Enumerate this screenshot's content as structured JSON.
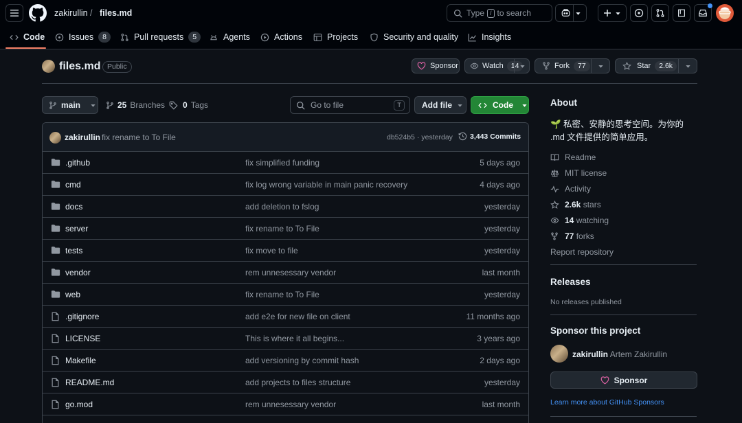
{
  "header": {
    "owner": "zakirullin",
    "separator": "/",
    "repo": "files.md",
    "search_prefix": "Type",
    "search_key": "/",
    "search_suffix": "to search"
  },
  "tabs": [
    {
      "label": "Code",
      "count": null
    },
    {
      "label": "Issues",
      "count": "8"
    },
    {
      "label": "Pull requests",
      "count": "5"
    },
    {
      "label": "Agents",
      "count": null
    },
    {
      "label": "Actions",
      "count": null
    },
    {
      "label": "Projects",
      "count": null
    },
    {
      "label": "Security and quality",
      "count": null
    },
    {
      "label": "Insights",
      "count": null
    }
  ],
  "repo": {
    "name": "files.md",
    "visibility": "Public",
    "sponsor_label": "Sponsor",
    "watch_label": "Watch",
    "watch_count": "14",
    "fork_label": "Fork",
    "fork_count": "77",
    "star_label": "Star",
    "star_count": "2.6k"
  },
  "toolbar": {
    "branch": "main",
    "branches_count": "25",
    "branches_label": "Branches",
    "tags_count": "0",
    "tags_label": "Tags",
    "goto_placeholder": "Go to file",
    "goto_key": "T",
    "add_file_label": "Add file",
    "code_label": "Code"
  },
  "commit": {
    "author": "zakirullin",
    "message": "fix rename to To File",
    "hash": "db524b5",
    "dot": "·",
    "time": "yesterday",
    "commits_label": "3,443 Commits"
  },
  "files": [
    {
      "name": ".github",
      "type": "folder",
      "message": "fix simplified funding",
      "date": "5 days ago"
    },
    {
      "name": "cmd",
      "type": "folder",
      "message": "fix log wrong variable in main panic recovery",
      "date": "4 days ago"
    },
    {
      "name": "docs",
      "type": "folder",
      "message": "add deletion to fslog",
      "date": "yesterday"
    },
    {
      "name": "server",
      "type": "folder",
      "message": "fix rename to To File",
      "date": "yesterday"
    },
    {
      "name": "tests",
      "type": "folder",
      "message": "fix move to file",
      "date": "yesterday"
    },
    {
      "name": "vendor",
      "type": "folder",
      "message": "rem unnesessary vendor",
      "date": "last month"
    },
    {
      "name": "web",
      "type": "folder",
      "message": "fix rename to To File",
      "date": "yesterday"
    },
    {
      "name": ".gitignore",
      "type": "file",
      "message": "add e2e for new file on client",
      "date": "11 months ago"
    },
    {
      "name": "LICENSE",
      "type": "file",
      "message": "This is where it all begins...",
      "date": "3 years ago"
    },
    {
      "name": "Makefile",
      "type": "file",
      "message": "add versioning by commit hash",
      "date": "2 days ago"
    },
    {
      "name": "README.md",
      "type": "file",
      "message": "add projects to files structure",
      "date": "yesterday"
    },
    {
      "name": "go.mod",
      "type": "file",
      "message": "rem unnesessary vendor",
      "date": "last month"
    }
  ],
  "about": {
    "title": "About",
    "description_line1": "🌱 私密、安静的思考空间。为你的",
    "description_line2": ".md 文件提供的简单应用。",
    "readme": "Readme",
    "license": "MIT license",
    "activity": "Activity",
    "stars_count": "2.6k",
    "stars_label": "stars",
    "watching_count": "14",
    "watching_label": "watching",
    "forks_count": "77",
    "forks_label": "forks",
    "report": "Report repository"
  },
  "releases": {
    "title": "Releases",
    "empty": "No releases published"
  },
  "sponsor": {
    "title": "Sponsor this project",
    "username": "zakirullin",
    "fullname": "Artem Zakirullin",
    "button_label": "Sponsor",
    "learn_more": "Learn more about GitHub Sponsors"
  },
  "colors": {
    "accent_green": "#238636",
    "link_blue": "#4493f8",
    "tab_underline": "#f78166",
    "sponsor_pink": "#db61a2"
  }
}
